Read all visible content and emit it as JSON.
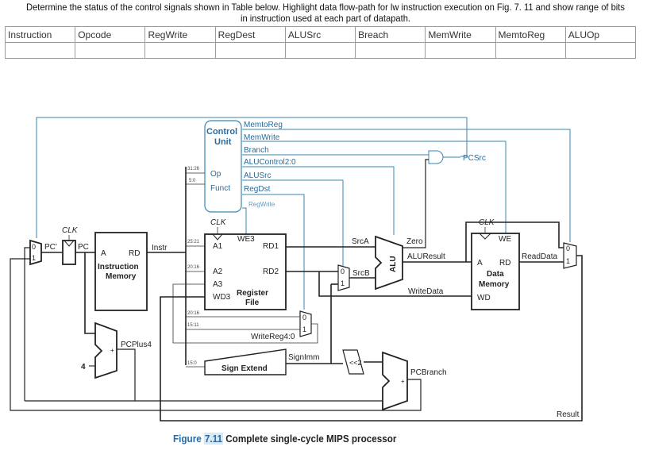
{
  "question": {
    "line1": "Determine the status of the control signals shown in Table below. Highlight data flow-path for lw instruction execution on Fig. 7. 11 and show range of bits",
    "line2": "in instruction used at each part of datapath."
  },
  "table": {
    "headers": [
      "Instruction",
      "Opcode",
      "RegWrite",
      "RegDest",
      "ALUSrc",
      "Breach",
      "MemWrite",
      "MemtoReg",
      "ALUOp"
    ],
    "rows": [
      [
        "",
        "",
        "",
        "",
        "",
        "",
        "",
        "",
        ""
      ]
    ]
  },
  "diagram": {
    "control_unit": {
      "title_line1": "Control",
      "title_line2": "Unit",
      "inputs": [
        "Op",
        "Funct"
      ],
      "outputs": [
        "MemtoReg",
        "MemWrite",
        "Branch",
        "ALUControl2:0",
        "ALUSrc",
        "RegDst",
        "RegWrite"
      ]
    },
    "control_input_bits": [
      "31:26",
      "5:0"
    ],
    "pcsrc": "PCSrc",
    "clk": "CLK",
    "pc_prime": "PC'",
    "pc": "PC",
    "instruction_memory": {
      "a": "A",
      "rd": "RD",
      "title_line1": "Instruction",
      "title_line2": "Memory"
    },
    "instr": "Instr",
    "register_file": {
      "a1": "A1",
      "a2": "A2",
      "a3": "A3",
      "wd3": "WD3",
      "we3": "WE3",
      "rd1": "RD1",
      "rd2": "RD2",
      "title_line1": "Register",
      "title_line2": "File"
    },
    "bit_ranges": {
      "rs": "25:21",
      "rt": "20:16",
      "rt2": "20:16",
      "rd": "15:11",
      "imm": "15:0"
    },
    "write_reg": "WriteReg4:0",
    "srca": "SrcA",
    "srcb": "SrcB",
    "alu": "ALU",
    "zero": "Zero",
    "alu_result": "ALUResult",
    "write_data": "WriteData",
    "data_memory": {
      "a": "A",
      "rd": "RD",
      "we": "WE",
      "wd": "WD",
      "title_line1": "Data",
      "title_line2": "Memory"
    },
    "read_data": "ReadData",
    "sign_extend": "Sign Extend",
    "sign_imm": "SignImm",
    "shift": "<<2",
    "pc_plus4": "PCPlus4",
    "four": "4",
    "pc_branch": "PCBranch",
    "result": "Result",
    "mux_labels": [
      "0",
      "1"
    ],
    "plus": "+"
  },
  "caption": {
    "figure": "Figure",
    "number": "7.11",
    "text": "Complete single-cycle MIPS processor"
  }
}
